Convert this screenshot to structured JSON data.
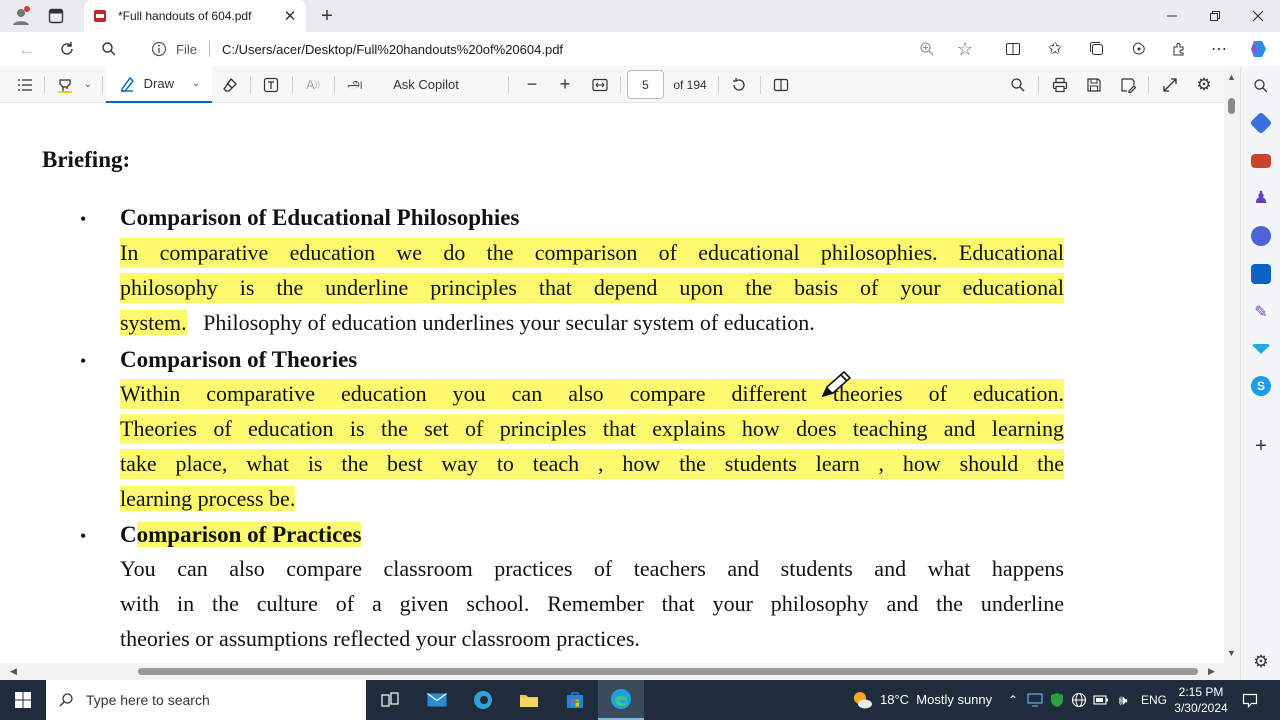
{
  "browser": {
    "tab_title": "*Full handouts of 604.pdf",
    "address_prefix": "File",
    "address_url": "C:/Users/acer/Desktop/Full%20handouts%20of%20604.pdf"
  },
  "pdf_toolbar": {
    "draw_label": "Draw",
    "copilot_label": "Ask Copilot",
    "page_number": "5",
    "page_total": "of 194"
  },
  "document": {
    "briefing": "Briefing:",
    "section1": {
      "heading": "Comparison of Educational Philosophies",
      "l1": "In comparative education we do the comparison of educational philosophies. Educational",
      "l2": "philosophy is the underline principles that depend upon the basis of your educational",
      "l3a": "system.",
      "l3b": "Philosophy of education underlines your secular system of education."
    },
    "section2": {
      "heading": "Comparison of Theories",
      "l1": "Within comparative education you can also compare different theories of education.",
      "l2": "Theories of education is the set of principles that explains how does teaching and learning",
      "l3": "take place, what is the best way to teach , how the students learn , how should the",
      "l4": "learning process be."
    },
    "section3": {
      "heading_first": "C",
      "heading_rest": "omparison of Practices",
      "l1": "You can also compare classroom practices of teachers and students and what happens",
      "l2": "with in the culture of a given school. Remember that your philosophy and the underline",
      "l3": "theories or assumptions reflected your classroom practices."
    },
    "bullet": "•"
  },
  "taskbar": {
    "search_placeholder": "Type here to search",
    "weather": "18°C  Mostly sunny",
    "language": "ENG",
    "time": "2:15 PM",
    "date": "3/30/2024"
  },
  "colors": {
    "highlight": "#fdf96e",
    "accent": "#0067c0"
  }
}
